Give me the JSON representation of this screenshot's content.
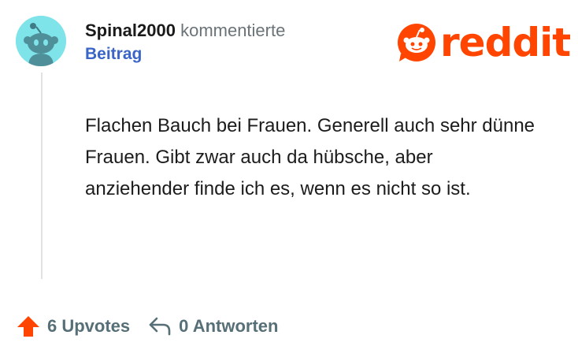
{
  "comment": {
    "username": "Spinal2000",
    "action": "kommentierte",
    "post_link": "Beitrag",
    "body": "Flachen Bauch bei Frauen. Generell auch sehr dünne Frauen. Gibt zwar auch da hübsche, aber anziehender finde ich es, wenn es nicht so ist.",
    "upvotes": "6 Upvotes",
    "replies": "0 Antworten"
  },
  "brand": {
    "name": "reddit",
    "color": "#ff4500"
  },
  "icons": {
    "avatar": "snoo-avatar-icon",
    "logo": "reddit-logo-icon",
    "upvote": "upvote-arrow-icon",
    "reply": "reply-arrow-icon"
  },
  "colors": {
    "avatar_bg": "#7fe3ea",
    "link": "#3a64c7",
    "upvote": "#ff4500",
    "muted": "#576f76"
  }
}
